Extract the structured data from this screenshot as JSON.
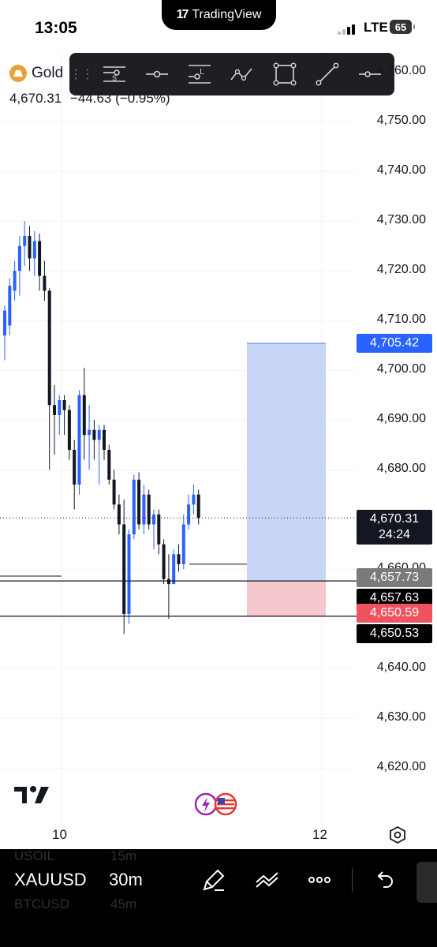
{
  "status_bar": {
    "time": "13:05",
    "app_pill": "TradingView",
    "app_logo": "17",
    "network": "LTE",
    "battery": "65"
  },
  "symbol": {
    "name": "Gold",
    "last_price": "4,670.31",
    "change": "−44.63 (−0.95%)"
  },
  "drawing_toolbar": {
    "tools": [
      {
        "icon": "short-position-icon",
        "glyph": "S"
      },
      {
        "icon": "horizontal-ray-icon"
      },
      {
        "icon": "long-position-icon",
        "glyph": "L"
      },
      {
        "icon": "path-icon"
      },
      {
        "icon": "rectangle-icon"
      },
      {
        "icon": "trend-line-icon"
      },
      {
        "icon": "horizontal-line-icon"
      }
    ]
  },
  "price_axis": {
    "labels": [
      "4,760.00",
      "4,750.00",
      "4,740.00",
      "4,730.00",
      "4,720.00",
      "4,710.00",
      "4,700.00",
      "4,690.00",
      "4,680.00",
      "4,660.00",
      "4,640.00",
      "4,630.00",
      "4,620.00"
    ],
    "tags": {
      "target": "4,705.42",
      "last": "4,670.31",
      "countdown": "24:24",
      "level_grey": "4,657.73",
      "level_black": "4,657.63",
      "stop": "4,650.59",
      "level_black_2": "4,650.53"
    }
  },
  "time_axis": {
    "labels": [
      "10",
      "12"
    ]
  },
  "colors": {
    "bull": "#2962ff",
    "bear": "#131722",
    "target_zone": "#c9d5f6",
    "stop_zone": "#f4c8cd",
    "target_tag": "#2962ff",
    "stop_tag": "#ef5360",
    "grey_tag": "#7a7a7a"
  },
  "chart_data": {
    "type": "candlestick",
    "ylim": [
      4614.2,
      4764.0
    ],
    "candles": [
      {
        "o": 4707.0,
        "h": 4713.0,
        "l": 4702.0,
        "c": 4712.0
      },
      {
        "o": 4709.0,
        "h": 4718.5,
        "l": 4707.0,
        "c": 4717.0
      },
      {
        "o": 4716.0,
        "h": 4722.0,
        "l": 4714.0,
        "c": 4720.0
      },
      {
        "o": 4720.0,
        "h": 4727.0,
        "l": 4715.0,
        "c": 4725.0
      },
      {
        "o": 4725.0,
        "h": 4730.0,
        "l": 4721.0,
        "c": 4727.0
      },
      {
        "o": 4727.0,
        "h": 4729.0,
        "l": 4720.0,
        "c": 4722.5
      },
      {
        "o": 4722.5,
        "h": 4728.0,
        "l": 4719.0,
        "c": 4726.0
      },
      {
        "o": 4726.0,
        "h": 4727.5,
        "l": 4716.0,
        "c": 4719.0
      },
      {
        "o": 4719.0,
        "h": 4722.0,
        "l": 4714.0,
        "c": 4716.0
      },
      {
        "o": 4716.0,
        "h": 4716.5,
        "l": 4680.0,
        "c": 4693.0
      },
      {
        "o": 4693.0,
        "h": 4697.0,
        "l": 4683.0,
        "c": 4691.0
      },
      {
        "o": 4691.0,
        "h": 4695.0,
        "l": 4687.0,
        "c": 4694.0
      },
      {
        "o": 4694.0,
        "h": 4695.0,
        "l": 4687.0,
        "c": 4692.0
      },
      {
        "o": 4692.0,
        "h": 4693.0,
        "l": 4682.0,
        "c": 4684.0
      },
      {
        "o": 4684.0,
        "h": 4686.0,
        "l": 4672.0,
        "c": 4677.0
      },
      {
        "o": 4677.0,
        "h": 4696.0,
        "l": 4675.0,
        "c": 4695.0
      },
      {
        "o": 4695.0,
        "h": 4700.5,
        "l": 4682.0,
        "c": 4687.0
      },
      {
        "o": 4687.0,
        "h": 4693.0,
        "l": 4680.0,
        "c": 4688.0
      },
      {
        "o": 4688.0,
        "h": 4690.0,
        "l": 4682.0,
        "c": 4686.0
      },
      {
        "o": 4686.0,
        "h": 4689.0,
        "l": 4677.0,
        "c": 4688.0
      },
      {
        "o": 4688.0,
        "h": 4689.0,
        "l": 4682.0,
        "c": 4684.0
      },
      {
        "o": 4684.0,
        "h": 4685.0,
        "l": 4677.0,
        "c": 4678.0
      },
      {
        "o": 4678.0,
        "h": 4680.0,
        "l": 4672.0,
        "c": 4673.0
      },
      {
        "o": 4673.0,
        "h": 4675.0,
        "l": 4667.0,
        "c": 4669.0
      },
      {
        "o": 4669.0,
        "h": 4674.0,
        "l": 4647.0,
        "c": 4651.0
      },
      {
        "o": 4651.0,
        "h": 4668.0,
        "l": 4649.0,
        "c": 4667.0
      },
      {
        "o": 4667.0,
        "h": 4679.0,
        "l": 4666.0,
        "c": 4678.0
      },
      {
        "o": 4678.0,
        "h": 4679.5,
        "l": 4668.0,
        "c": 4669.0
      },
      {
        "o": 4669.0,
        "h": 4677.0,
        "l": 4667.0,
        "c": 4675.0
      },
      {
        "o": 4675.0,
        "h": 4676.0,
        "l": 4668.0,
        "c": 4669.0
      },
      {
        "o": 4669.0,
        "h": 4672.0,
        "l": 4664.0,
        "c": 4671.0
      },
      {
        "o": 4671.0,
        "h": 4672.0,
        "l": 4663.0,
        "c": 4665.0
      },
      {
        "o": 4665.0,
        "h": 4666.0,
        "l": 4657.0,
        "c": 4658.0
      },
      {
        "o": 4658.0,
        "h": 4663.0,
        "l": 4650.0,
        "c": 4657.0
      },
      {
        "o": 4657.0,
        "h": 4664.0,
        "l": 4657.0,
        "c": 4663.0
      },
      {
        "o": 4663.0,
        "h": 4665.0,
        "l": 4659.5,
        "c": 4661.0
      },
      {
        "o": 4661.0,
        "h": 4671.0,
        "l": 4660.0,
        "c": 4669.0
      },
      {
        "o": 4669.0,
        "h": 4675.0,
        "l": 4668.0,
        "c": 4673.0
      },
      {
        "o": 4673.0,
        "h": 4677.0,
        "l": 4671.0,
        "c": 4675.0
      },
      {
        "o": 4675.0,
        "h": 4676.0,
        "l": 4669.0,
        "c": 4670.31
      }
    ],
    "long_position": {
      "entry": 4657.73,
      "target": 4705.42,
      "stop": 4650.59
    },
    "horizontal_levels": [
      4657.63,
      4650.53
    ],
    "x_ticks": [
      "10",
      "12"
    ]
  },
  "bottom_toolbar": {
    "symbol": "XAUUSD",
    "interval": "30m",
    "ghost_above_symbol": "USOIL",
    "ghost_above_interval": "15m",
    "ghost_below_symbol": "BTCUSD",
    "ghost_below_interval": "45m",
    "icons": [
      "brush-icon",
      "drawings-icon",
      "more-icon",
      "undo-icon"
    ]
  }
}
